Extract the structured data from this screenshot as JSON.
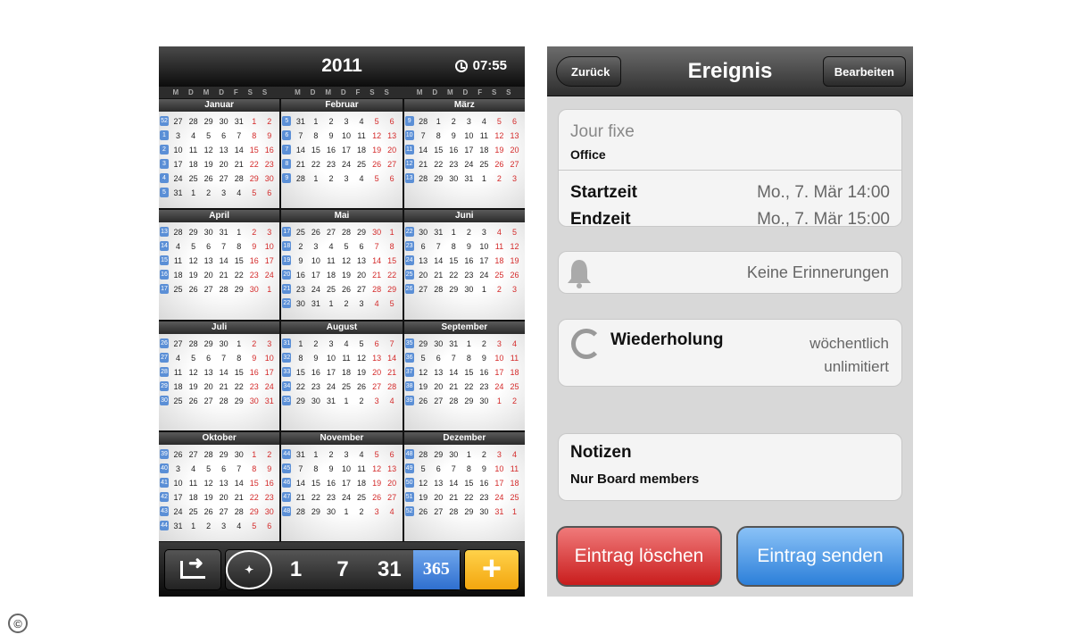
{
  "calendar": {
    "year": "2011",
    "time": "07:55",
    "weekday_headers": [
      "M",
      "D",
      "M",
      "D",
      "F",
      "S",
      "S"
    ],
    "months": [
      {
        "name": "Januar",
        "weeks": [
          [
            "52",
            "27",
            "28",
            "29",
            "30",
            "31",
            "1",
            "2"
          ],
          [
            "1",
            "3",
            "4",
            "5",
            "6",
            "7",
            "8",
            "9"
          ],
          [
            "2",
            "10",
            "11",
            "12",
            "13",
            "14",
            "15",
            "16"
          ],
          [
            "3",
            "17",
            "18",
            "19",
            "20",
            "21",
            "22",
            "23"
          ],
          [
            "4",
            "24",
            "25",
            "26",
            "27",
            "28",
            "29",
            "30"
          ],
          [
            "5",
            "31",
            "1",
            "2",
            "3",
            "4",
            "5",
            "6"
          ]
        ]
      },
      {
        "name": "Februar",
        "weeks": [
          [
            "5",
            "31",
            "1",
            "2",
            "3",
            "4",
            "5",
            "6"
          ],
          [
            "6",
            "7",
            "8",
            "9",
            "10",
            "11",
            "12",
            "13"
          ],
          [
            "7",
            "14",
            "15",
            "16",
            "17",
            "18",
            "19",
            "20"
          ],
          [
            "8",
            "21",
            "22",
            "23",
            "24",
            "25",
            "26",
            "27"
          ],
          [
            "9",
            "28",
            "1",
            "2",
            "3",
            "4",
            "5",
            "6"
          ]
        ]
      },
      {
        "name": "März",
        "weeks": [
          [
            "9",
            "28",
            "1",
            "2",
            "3",
            "4",
            "5",
            "6"
          ],
          [
            "10",
            "7",
            "8",
            "9",
            "10",
            "11",
            "12",
            "13"
          ],
          [
            "11",
            "14",
            "15",
            "16",
            "17",
            "18",
            "19",
            "20"
          ],
          [
            "12",
            "21",
            "22",
            "23",
            "24",
            "25",
            "26",
            "27"
          ],
          [
            "13",
            "28",
            "29",
            "30",
            "31",
            "1",
            "2",
            "3"
          ]
        ]
      },
      {
        "name": "April",
        "weeks": [
          [
            "13",
            "28",
            "29",
            "30",
            "31",
            "1",
            "2",
            "3"
          ],
          [
            "14",
            "4",
            "5",
            "6",
            "7",
            "8",
            "9",
            "10"
          ],
          [
            "15",
            "11",
            "12",
            "13",
            "14",
            "15",
            "16",
            "17"
          ],
          [
            "16",
            "18",
            "19",
            "20",
            "21",
            "22",
            "23",
            "24"
          ],
          [
            "17",
            "25",
            "26",
            "27",
            "28",
            "29",
            "30",
            "1"
          ]
        ]
      },
      {
        "name": "Mai",
        "weeks": [
          [
            "17",
            "25",
            "26",
            "27",
            "28",
            "29",
            "30",
            "1"
          ],
          [
            "18",
            "2",
            "3",
            "4",
            "5",
            "6",
            "7",
            "8"
          ],
          [
            "19",
            "9",
            "10",
            "11",
            "12",
            "13",
            "14",
            "15"
          ],
          [
            "20",
            "16",
            "17",
            "18",
            "19",
            "20",
            "21",
            "22"
          ],
          [
            "21",
            "23",
            "24",
            "25",
            "26",
            "27",
            "28",
            "29"
          ],
          [
            "22",
            "30",
            "31",
            "1",
            "2",
            "3",
            "4",
            "5"
          ]
        ]
      },
      {
        "name": "Juni",
        "weeks": [
          [
            "22",
            "30",
            "31",
            "1",
            "2",
            "3",
            "4",
            "5"
          ],
          [
            "23",
            "6",
            "7",
            "8",
            "9",
            "10",
            "11",
            "12"
          ],
          [
            "24",
            "13",
            "14",
            "15",
            "16",
            "17",
            "18",
            "19"
          ],
          [
            "25",
            "20",
            "21",
            "22",
            "23",
            "24",
            "25",
            "26"
          ],
          [
            "26",
            "27",
            "28",
            "29",
            "30",
            "1",
            "2",
            "3"
          ]
        ]
      },
      {
        "name": "Juli",
        "weeks": [
          [
            "26",
            "27",
            "28",
            "29",
            "30",
            "1",
            "2",
            "3"
          ],
          [
            "27",
            "4",
            "5",
            "6",
            "7",
            "8",
            "9",
            "10"
          ],
          [
            "28",
            "11",
            "12",
            "13",
            "14",
            "15",
            "16",
            "17"
          ],
          [
            "29",
            "18",
            "19",
            "20",
            "21",
            "22",
            "23",
            "24"
          ],
          [
            "30",
            "25",
            "26",
            "27",
            "28",
            "29",
            "30",
            "31"
          ]
        ]
      },
      {
        "name": "August",
        "weeks": [
          [
            "31",
            "1",
            "2",
            "3",
            "4",
            "5",
            "6",
            "7"
          ],
          [
            "32",
            "8",
            "9",
            "10",
            "11",
            "12",
            "13",
            "14"
          ],
          [
            "33",
            "15",
            "16",
            "17",
            "18",
            "19",
            "20",
            "21"
          ],
          [
            "34",
            "22",
            "23",
            "24",
            "25",
            "26",
            "27",
            "28"
          ],
          [
            "35",
            "29",
            "30",
            "31",
            "1",
            "2",
            "3",
            "4"
          ]
        ]
      },
      {
        "name": "September",
        "weeks": [
          [
            "35",
            "29",
            "30",
            "31",
            "1",
            "2",
            "3",
            "4"
          ],
          [
            "36",
            "5",
            "6",
            "7",
            "8",
            "9",
            "10",
            "11"
          ],
          [
            "37",
            "12",
            "13",
            "14",
            "15",
            "16",
            "17",
            "18"
          ],
          [
            "38",
            "19",
            "20",
            "21",
            "22",
            "23",
            "24",
            "25"
          ],
          [
            "39",
            "26",
            "27",
            "28",
            "29",
            "30",
            "1",
            "2"
          ]
        ]
      },
      {
        "name": "Oktober",
        "weeks": [
          [
            "39",
            "26",
            "27",
            "28",
            "29",
            "30",
            "1",
            "2"
          ],
          [
            "40",
            "3",
            "4",
            "5",
            "6",
            "7",
            "8",
            "9"
          ],
          [
            "41",
            "10",
            "11",
            "12",
            "13",
            "14",
            "15",
            "16"
          ],
          [
            "42",
            "17",
            "18",
            "19",
            "20",
            "21",
            "22",
            "23"
          ],
          [
            "43",
            "24",
            "25",
            "26",
            "27",
            "28",
            "29",
            "30"
          ],
          [
            "44",
            "31",
            "1",
            "2",
            "3",
            "4",
            "5",
            "6"
          ]
        ]
      },
      {
        "name": "November",
        "weeks": [
          [
            "44",
            "31",
            "1",
            "2",
            "3",
            "4",
            "5",
            "6"
          ],
          [
            "45",
            "7",
            "8",
            "9",
            "10",
            "11",
            "12",
            "13"
          ],
          [
            "46",
            "14",
            "15",
            "16",
            "17",
            "18",
            "19",
            "20"
          ],
          [
            "47",
            "21",
            "22",
            "23",
            "24",
            "25",
            "26",
            "27"
          ],
          [
            "48",
            "28",
            "29",
            "30",
            "1",
            "2",
            "3",
            "4"
          ]
        ]
      },
      {
        "name": "Dezember",
        "weeks": [
          [
            "48",
            "28",
            "29",
            "30",
            "1",
            "2",
            "3",
            "4"
          ],
          [
            "49",
            "5",
            "6",
            "7",
            "8",
            "9",
            "10",
            "11"
          ],
          [
            "50",
            "12",
            "13",
            "14",
            "15",
            "16",
            "17",
            "18"
          ],
          [
            "51",
            "19",
            "20",
            "21",
            "22",
            "23",
            "24",
            "25"
          ],
          [
            "52",
            "26",
            "27",
            "28",
            "29",
            "30",
            "31",
            "1"
          ]
        ]
      }
    ],
    "toolbar": {
      "share_icon": "share-arrow-icon",
      "view_icon": "compass-icon",
      "views": [
        "1",
        "7",
        "31",
        "365"
      ],
      "selected_view": "365",
      "add_label": "+"
    }
  },
  "event": {
    "nav": {
      "back_label": "Zurück",
      "title": "Ereignis",
      "edit_label": "Bearbeiten"
    },
    "title": "Jour fixe",
    "location": "Office",
    "start_label": "Startzeit",
    "start_value": "Mo., 7. Mär 14:00",
    "end_label": "Endzeit",
    "end_value": "Mo., 7. Mär 15:00",
    "reminder_icon": "bell-icon",
    "reminder_text": "Keine Erinnerungen",
    "repeat_icon": "repeat-icon",
    "repeat_label": "Wiederholung",
    "repeat_value_1": "wöchentlich",
    "repeat_value_2": "unlimitiert",
    "notes_label": "Notizen",
    "notes_text": "Nur Board members",
    "delete_label": "Eintrag löschen",
    "send_label": "Eintrag senden"
  },
  "copyright_symbol": "©",
  "colors": {
    "week_blue": "#5b8fd6",
    "sunday_red": "#d42a2a",
    "delete_red": "#c91d1d",
    "send_blue": "#2c7fd9",
    "add_yellow": "#f3a60e"
  }
}
